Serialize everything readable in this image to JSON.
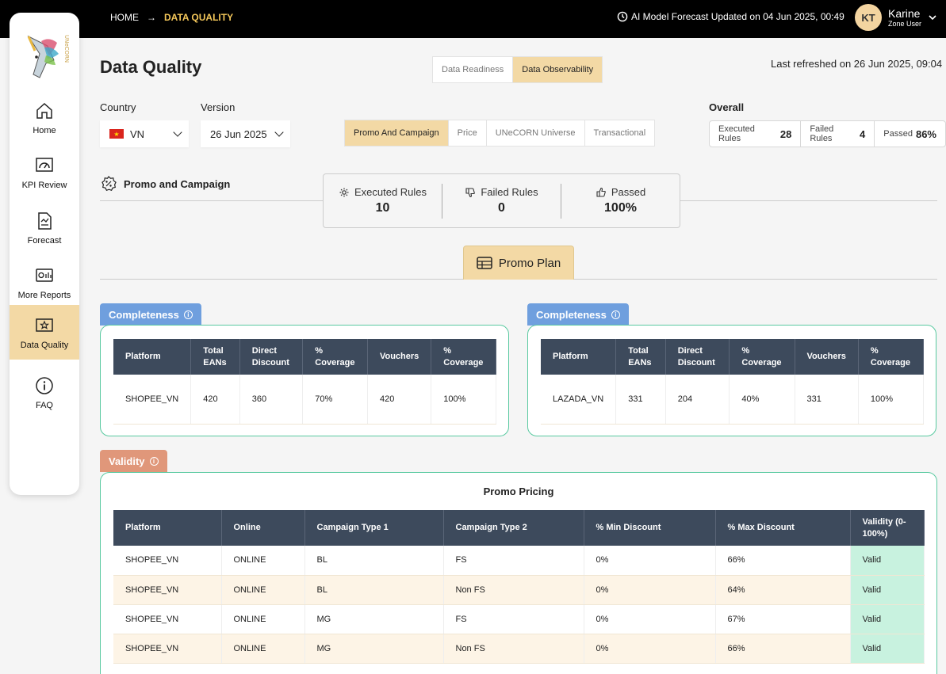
{
  "breadcrumb": {
    "home": "HOME",
    "arrow": "→",
    "current": "DATA QUALITY"
  },
  "forecast_notice": "AI Model Forecast Updated on 04 Jun 2025, 00:49",
  "user": {
    "initials": "KT",
    "name": "Karine",
    "role": "Zone User"
  },
  "logo_text": "UNeCORN",
  "nav": [
    {
      "label": "Home",
      "icon": "home-icon"
    },
    {
      "label": "KPI Review",
      "icon": "gauge-icon"
    },
    {
      "label": "Forecast",
      "icon": "document-chart-icon"
    },
    {
      "label": "More Reports",
      "icon": "reports-icon"
    },
    {
      "label": "Data Quality",
      "icon": "star-monitor-icon"
    },
    {
      "label": "FAQ",
      "icon": "info-icon"
    }
  ],
  "page_title": "Data Quality",
  "view_tabs": [
    "Data Readiness",
    "Data Observability"
  ],
  "last_refreshed": "Last refreshed on 26 Jun 2025, 09:04",
  "filters": {
    "country_label": "Country",
    "country_value": "VN",
    "version_label": "Version",
    "version_value": "26 Jun 2025"
  },
  "category_tabs": [
    "Promo And Campaign",
    "Price",
    "UNeCORN Universe",
    "Transactional"
  ],
  "overall": {
    "label": "Overall",
    "executed_label": "Executed Rules",
    "executed_value": "28",
    "failed_label": "Failed Rules",
    "failed_value": "4",
    "passed_label": "Passed",
    "passed_value": "86%"
  },
  "section": {
    "title": "Promo and Campaign",
    "executed_label": "Executed Rules",
    "executed_value": "10",
    "failed_label": "Failed Rules",
    "failed_value": "0",
    "passed_label": "Passed",
    "passed_value": "100%"
  },
  "promo_plan_label": "Promo Plan",
  "completeness_label": "Completeness",
  "completeness_headers": [
    "Platform",
    "Total EANs",
    "Direct Discount",
    "% Coverage",
    "Vouchers",
    "% Coverage"
  ],
  "completeness_left": [
    "SHOPEE_VN",
    "420",
    "360",
    "70%",
    "420",
    "100%"
  ],
  "completeness_right": [
    "LAZADA_VN",
    "331",
    "204",
    "40%",
    "331",
    "100%"
  ],
  "validity_label": "Validity",
  "promo_pricing_title": "Promo Pricing",
  "validity_headers": [
    "Platform",
    "Online",
    "Campaign Type 1",
    "Campaign Type 2",
    "% Min Discount",
    "% Max Discount",
    "Validity (0-100%)"
  ],
  "validity_rows": [
    [
      "SHOPEE_VN",
      "ONLINE",
      "BL",
      "FS",
      "0%",
      "66%",
      "Valid"
    ],
    [
      "SHOPEE_VN",
      "ONLINE",
      "BL",
      "Non FS",
      "0%",
      "64%",
      "Valid"
    ],
    [
      "SHOPEE_VN",
      "ONLINE",
      "MG",
      "FS",
      "0%",
      "67%",
      "Valid"
    ],
    [
      "SHOPEE_VN",
      "ONLINE",
      "MG",
      "Non FS",
      "0%",
      "66%",
      "Valid"
    ]
  ],
  "colors": {
    "accent": "#f3d9a5",
    "highlight": "#f4c75a",
    "header_dark": "#3d4a5c",
    "card_border": "#59c9a0",
    "valid_bg": "#c8f2df",
    "completeness_tag": "#6f9fde",
    "validity_tag": "#e0977a"
  }
}
